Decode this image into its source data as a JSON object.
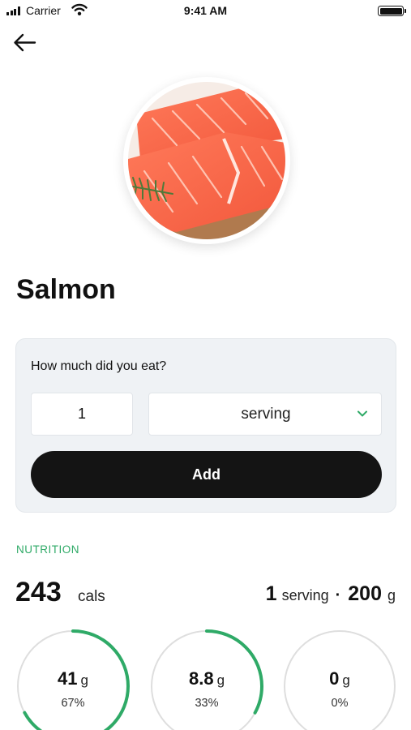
{
  "status_bar": {
    "carrier": "Carrier",
    "time": "9:41 AM"
  },
  "food": {
    "name": "Salmon"
  },
  "portion": {
    "question": "How much did you eat?",
    "quantity": "1",
    "unit": "serving",
    "add_label": "Add"
  },
  "nutrition": {
    "section_label": "NUTRITION",
    "calories": "243",
    "calories_unit": "cals",
    "serving_count": "1",
    "serving_unit": "serving",
    "separator": "·",
    "serving_weight": "200",
    "serving_weight_unit": "g",
    "macros": [
      {
        "amount": "41",
        "unit": "g",
        "percent_label": "67%",
        "fraction": 0.67
      },
      {
        "amount": "8.8",
        "unit": "g",
        "percent_label": "33%",
        "fraction": 0.33
      },
      {
        "amount": "0",
        "unit": "g",
        "percent_label": "0%",
        "fraction": 0
      }
    ]
  },
  "colors": {
    "accent": "#2faa67",
    "ring_track": "#dedede",
    "card_bg": "#eff2f5",
    "button_bg": "#141414"
  },
  "icons": [
    "signal-icon",
    "wifi-icon",
    "battery-icon",
    "back-arrow-icon",
    "chevron-down-icon"
  ]
}
